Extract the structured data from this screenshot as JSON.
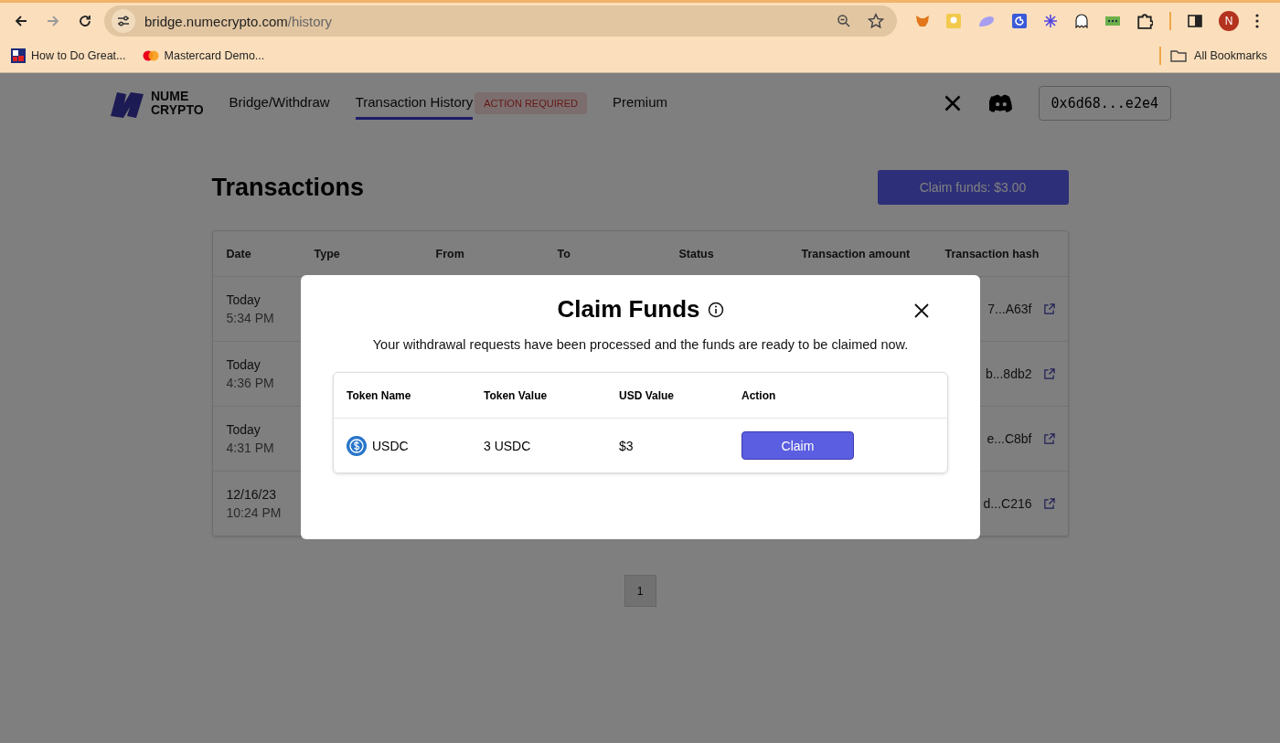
{
  "browser": {
    "url": {
      "host": "bridge.numecrypto.com",
      "path": "/history"
    },
    "bookmarks": [
      {
        "label": "How to Do Great...",
        "kind": "grid"
      },
      {
        "label": "Mastercard Demo...",
        "kind": "circles"
      }
    ],
    "all_bookmarks": "All Bookmarks",
    "profile_initial": "N"
  },
  "site": {
    "logo": [
      "NUME",
      "CRYPTO"
    ],
    "nav": [
      {
        "label": "Bridge/Withdraw",
        "selected": false
      },
      {
        "label": "Transaction History",
        "selected": true,
        "badge": "ACTION REQUIRED"
      },
      {
        "label": "Premium",
        "selected": false
      }
    ],
    "wallet": "0x6d68...e2e4"
  },
  "page": {
    "title": "Transactions",
    "claim_button": "Claim funds: $3.00",
    "columns": [
      "Date",
      "Type",
      "From",
      "To",
      "Status",
      "Transaction amount",
      "Transaction hash"
    ],
    "rows": [
      {
        "date": "Today",
        "time": "5:34 PM",
        "hash": "7...A63f"
      },
      {
        "date": "Today",
        "time": "4:36 PM",
        "hash": "b...8db2"
      },
      {
        "date": "Today",
        "time": "4:31 PM",
        "hash": "e...C8bf"
      },
      {
        "date": "12/16/23",
        "time": "10:24 PM",
        "hash": "d...C216"
      }
    ],
    "pagination": [
      {
        "label": "1",
        "selected": true
      }
    ]
  },
  "modal": {
    "title": "Claim Funds",
    "subtitle": "Your withdrawal requests have been processed and the funds are ready to be claimed now.",
    "columns": [
      "Token Name",
      "Token Value",
      "USD Value",
      "Action"
    ],
    "rows": [
      {
        "token": "USDC",
        "token_value": "3 USDC",
        "usd_value": "$3",
        "action": "Claim"
      }
    ]
  }
}
